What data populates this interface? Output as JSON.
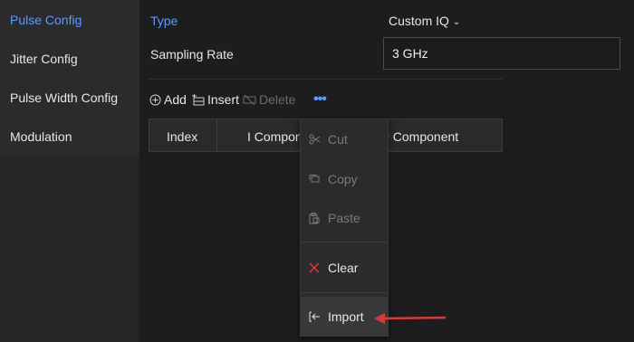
{
  "sidebar": {
    "items": [
      {
        "label": "Pulse Config",
        "active": true
      },
      {
        "label": "Jitter Config"
      },
      {
        "label": "Pulse Width Config"
      },
      {
        "label": "Modulation"
      }
    ]
  },
  "form": {
    "type_label": "Type",
    "type_value": "Custom IQ",
    "rate_label": "Sampling Rate",
    "rate_value": "3 GHz"
  },
  "toolbar": {
    "add_label": "Add",
    "insert_label": "Insert",
    "delete_label": "Delete",
    "more_label": "•••"
  },
  "table": {
    "headers": [
      "Index",
      "I Component",
      "Q Component"
    ]
  },
  "context_menu": {
    "items": [
      {
        "label": "Cut",
        "icon": "scissors-icon",
        "enabled": false
      },
      {
        "label": "Copy",
        "icon": "copy-icon",
        "enabled": false
      },
      {
        "label": "Paste",
        "icon": "paste-icon",
        "enabled": false
      },
      {
        "label": "Clear",
        "icon": "x-icon",
        "enabled": true
      },
      {
        "label": "Import",
        "icon": "import-icon",
        "enabled": true
      }
    ]
  },
  "colors": {
    "accent": "#5a9bff",
    "danger": "#e03a3a",
    "annotation_arrow": "#d63b3b"
  }
}
